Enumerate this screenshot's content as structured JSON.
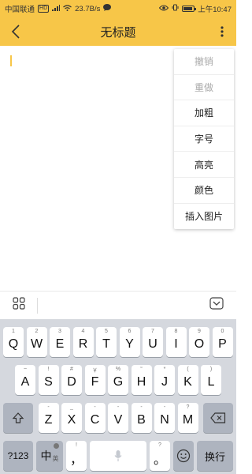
{
  "status_bar": {
    "carrier": "中国联通",
    "carrier_badge": "HD",
    "speed": "23.7B/s",
    "time": "上午10:47"
  },
  "app_bar": {
    "title": "无标题"
  },
  "menu": {
    "items": [
      {
        "label": "撤销",
        "enabled": false
      },
      {
        "label": "重做",
        "enabled": false
      },
      {
        "label": "加粗",
        "enabled": true
      },
      {
        "label": "字号",
        "enabled": true
      },
      {
        "label": "高亮",
        "enabled": true
      },
      {
        "label": "颜色",
        "enabled": true
      },
      {
        "label": "插入图片",
        "enabled": true
      }
    ]
  },
  "keyboard": {
    "row1": [
      {
        "k": "Q",
        "s": "1"
      },
      {
        "k": "W",
        "s": "2"
      },
      {
        "k": "E",
        "s": "3"
      },
      {
        "k": "R",
        "s": "4"
      },
      {
        "k": "T",
        "s": "5"
      },
      {
        "k": "Y",
        "s": "6"
      },
      {
        "k": "U",
        "s": "7"
      },
      {
        "k": "I",
        "s": "8"
      },
      {
        "k": "O",
        "s": "9"
      },
      {
        "k": "P",
        "s": "0"
      }
    ],
    "row2": [
      {
        "k": "A",
        "s": "~"
      },
      {
        "k": "S",
        "s": "!"
      },
      {
        "k": "D",
        "s": "#"
      },
      {
        "k": "F",
        "s": "￥"
      },
      {
        "k": "G",
        "s": "%"
      },
      {
        "k": "H",
        "s": "“"
      },
      {
        "k": "J",
        "s": "*"
      },
      {
        "k": "K",
        "s": "("
      },
      {
        "k": "L",
        "s": ")"
      }
    ],
    "row3": [
      {
        "k": "Z",
        "s": "-"
      },
      {
        "k": "X",
        "s": "_"
      },
      {
        "k": "C",
        "s": "-"
      },
      {
        "k": "V",
        "s": "-"
      },
      {
        "k": "B",
        "s": "-"
      },
      {
        "k": "N",
        "s": "-"
      },
      {
        "k": "M",
        "s": "?"
      }
    ],
    "numbers_key": "?123",
    "lang_key": "中",
    "lang_key_sub": "英",
    "comma_key": "，",
    "comma_key_sub": "!",
    "period_key": "。",
    "period_key_sub": "?",
    "enter_key": "换行"
  },
  "colors": {
    "accent": "#f7c648",
    "keyboard_bg": "#d5d8de",
    "function_key": "#aeb4bf"
  }
}
